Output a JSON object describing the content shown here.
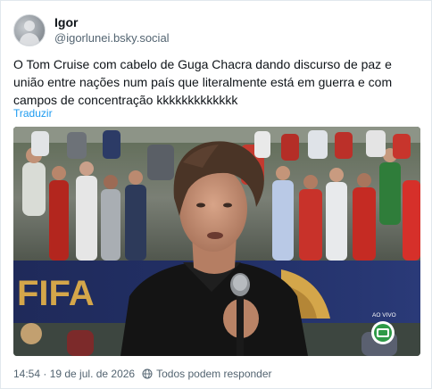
{
  "post": {
    "display_name": "Igor",
    "handle": "@igorlunei.bsky.social",
    "text": "O Tom Cruise com cabelo de Guga Chacra dando discurso de paz e união entre nações num país que literalmente está em guerra e com campos de concentração kkkkkkkkkkkkk",
    "translate_label": "Traduzir",
    "timestamp": "14:54 · 19 de jul. de 2026",
    "reply_setting": "Todos podem responder"
  },
  "media": {
    "banner_text": "FIFA",
    "live_label": "AO VIVO",
    "icons": [
      "avatar",
      "globe-icon",
      "broadcaster-logo"
    ]
  },
  "colors": {
    "link": "#1d9bf0",
    "secondary_text": "#536471",
    "border": "#e1e8ed"
  }
}
